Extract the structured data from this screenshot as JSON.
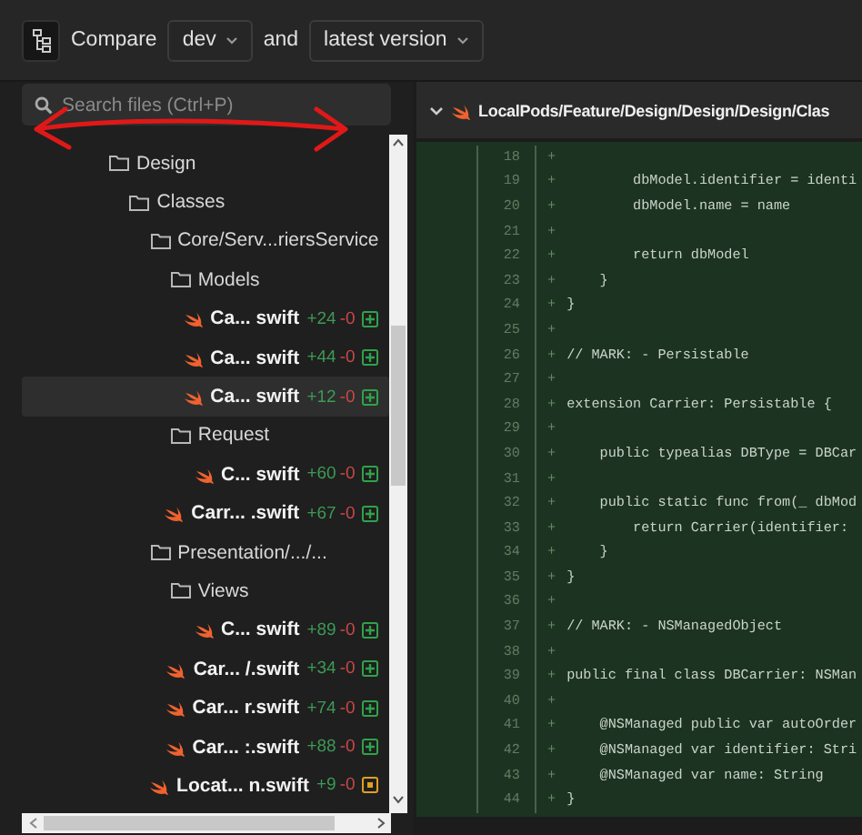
{
  "toolbar": {
    "compare_label": "Compare",
    "base": "dev",
    "joiner": "and",
    "target": "latest version"
  },
  "search": {
    "placeholder": "Search files (Ctrl+P)"
  },
  "tree": [
    {
      "kind": "folder",
      "name": "Design",
      "selected": false,
      "children": [
        {
          "kind": "folder",
          "name": "Classes",
          "selected": false,
          "children": [
            {
              "kind": "folder",
              "name": "Core/Serv...riersService",
              "selected": false,
              "children": [
                {
                  "kind": "folder",
                  "name": "Models",
                  "selected": false,
                  "children": [
                    {
                      "kind": "file",
                      "name": "Ca... swift",
                      "added": "+24",
                      "removed": "-0",
                      "modified": false,
                      "selected": false
                    },
                    {
                      "kind": "file",
                      "name": "Ca... swift",
                      "added": "+44",
                      "removed": "-0",
                      "modified": false,
                      "selected": false
                    },
                    {
                      "kind": "file",
                      "name": "Ca... swift",
                      "added": "+12",
                      "removed": "-0",
                      "modified": false,
                      "selected": true
                    }
                  ]
                },
                {
                  "kind": "folder",
                  "name": "Request",
                  "selected": false,
                  "children": [
                    {
                      "kind": "file",
                      "name": "C... swift",
                      "added": "+60",
                      "removed": "-0",
                      "modified": false,
                      "selected": false
                    }
                  ]
                },
                {
                  "kind": "file",
                  "name": "Carr... .swift",
                  "added": "+67",
                  "removed": "-0",
                  "modified": false,
                  "selected": false
                }
              ]
            },
            {
              "kind": "folder",
              "name": "Presentation/.../...",
              "selected": false,
              "children": [
                {
                  "kind": "folder",
                  "name": "Views",
                  "selected": false,
                  "children": [
                    {
                      "kind": "file",
                      "name": "C... swift",
                      "added": "+89",
                      "removed": "-0",
                      "modified": false,
                      "selected": false
                    }
                  ]
                },
                {
                  "kind": "file",
                  "name": "Car... /.swift",
                  "added": "+34",
                  "removed": "-0",
                  "modified": false,
                  "selected": false
                },
                {
                  "kind": "file",
                  "name": "Car... r.swift",
                  "added": "+74",
                  "removed": "-0",
                  "modified": false,
                  "selected": false
                },
                {
                  "kind": "file",
                  "name": "Car... :.swift",
                  "added": "+88",
                  "removed": "-0",
                  "modified": false,
                  "selected": false
                }
              ]
            },
            {
              "kind": "file",
              "name": "Locat... n.swift",
              "added": "+9",
              "removed": "-0",
              "modified": true,
              "selected": false
            }
          ]
        }
      ]
    }
  ],
  "diff": {
    "path": "LocalPods/Feature/Design/Design/Design/Clas",
    "expanded": true,
    "lines": [
      {
        "number": "18",
        "sign": "+"
      },
      {
        "number": "19",
        "sign": "+",
        "code": "        dbModel.identifier = identi"
      },
      {
        "number": "20",
        "sign": "+",
        "code": "        dbModel.name = name"
      },
      {
        "number": "21",
        "sign": "+"
      },
      {
        "number": "22",
        "sign": "+",
        "code": "        return dbModel"
      },
      {
        "number": "23",
        "sign": "+",
        "code": "    }"
      },
      {
        "number": "24",
        "sign": "+",
        "code": "}"
      },
      {
        "number": "25",
        "sign": "+"
      },
      {
        "number": "26",
        "sign": "+",
        "code": "// MARK: - Persistable"
      },
      {
        "number": "27",
        "sign": "+"
      },
      {
        "number": "28",
        "sign": "+",
        "code": "extension Carrier: Persistable {"
      },
      {
        "number": "29",
        "sign": "+"
      },
      {
        "number": "30",
        "sign": "+",
        "code": "    public typealias DBType = DBCar"
      },
      {
        "number": "31",
        "sign": "+"
      },
      {
        "number": "32",
        "sign": "+",
        "code": "    public static func from(_ dbMod"
      },
      {
        "number": "33",
        "sign": "+",
        "code": "        return Carrier(identifier:"
      },
      {
        "number": "34",
        "sign": "+",
        "code": "    }"
      },
      {
        "number": "35",
        "sign": "+",
        "code": "}"
      },
      {
        "number": "36",
        "sign": "+"
      },
      {
        "number": "37",
        "sign": "+",
        "code": "// MARK: - NSManagedObject"
      },
      {
        "number": "38",
        "sign": "+"
      },
      {
        "number": "39",
        "sign": "+",
        "code": "public final class DBCarrier: NSMan"
      },
      {
        "number": "40",
        "sign": "+"
      },
      {
        "number": "41",
        "sign": "+",
        "code": "    @NSManaged public var autoOrder"
      },
      {
        "number": "42",
        "sign": "+",
        "code": "    @NSManaged var identifier: Stri"
      },
      {
        "number": "43",
        "sign": "+",
        "code": "    @NSManaged var name: String"
      },
      {
        "number": "44",
        "sign": "+",
        "code": "}"
      }
    ]
  }
}
